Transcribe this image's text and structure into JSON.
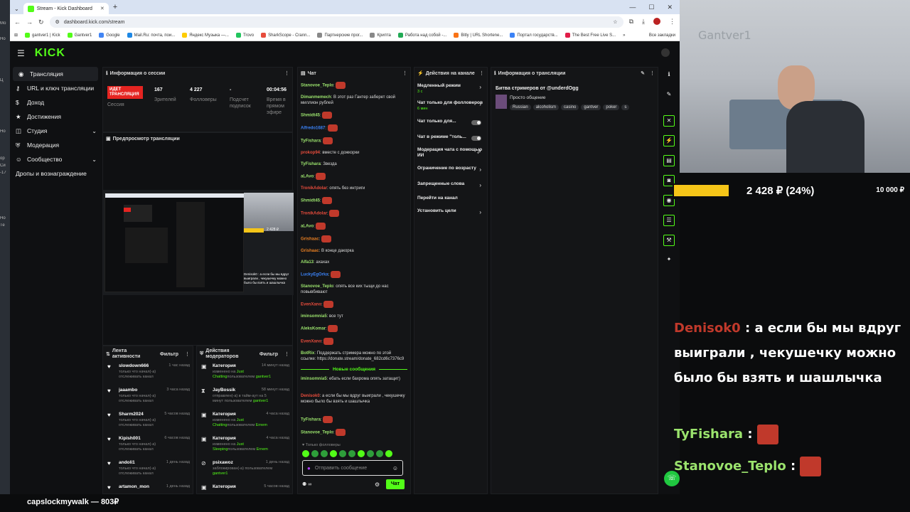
{
  "desktop": {
    "icons": [
      "Мо",
      "Но",
      "Ц",
      "Но",
      "ор",
      "Си",
      "-17",
      "Но",
      "Те"
    ]
  },
  "browser": {
    "tab_title": "Stream - Kick Dashboard",
    "new_tab": "+",
    "url": "dashboard.kick.com/stream",
    "bookmarks": [
      "gantver1 | Kick",
      "Gantver1",
      "Google",
      "Mail.Ru: почта, пои...",
      "Яндекс Музыка —...",
      "Trovo",
      "SharkScope - Crann...",
      "Партнерские прог...",
      "Крипта",
      "Работа над собой -...",
      "Bitly | URL Shortene...",
      "Портал государств...",
      "The Best Free Live S..."
    ],
    "bookmarks_all": "Все закладки"
  },
  "app": {
    "logo": "KICK",
    "sidebar": [
      {
        "label": "Трансляция",
        "active": true
      },
      {
        "label": "URL и ключ трансляции"
      },
      {
        "label": "Доход"
      },
      {
        "label": "Достижения"
      },
      {
        "label": "Студия",
        "chevron": "⌄"
      },
      {
        "label": "Модерация"
      },
      {
        "label": "Сообщество",
        "chevron": "⌄"
      },
      {
        "label": "Дропы и вознаграждение"
      }
    ],
    "session": {
      "title": "Информация о сессии",
      "live": "ИДЕТ ТРАНСЛЯЦИЯ",
      "live_label": "Сессия",
      "viewers": "167",
      "viewers_label": "Зрителей",
      "followers": "4 227",
      "followers_label": "Фолловеры",
      "subs": "-",
      "subs_label": "Подсчет подписок",
      "airtime": "00:04:56",
      "airtime_label": "Время в прямом эфире"
    },
    "preview": {
      "title": "Предпросмотр трансляции",
      "overlay_amount": "2 428 ₽",
      "overlay_chat": "Denisok0 : а если бы мы вдруг выиграли , чекушечку можно было бы взять и шашлычка"
    },
    "activity": {
      "title": "Лента активности",
      "filter": "Фильтр",
      "items": [
        {
          "user": "slowdown666",
          "time": "1 час назад",
          "text": "только что начал(-а) отслеживать канал"
        },
        {
          "user": "jaaambo",
          "time": "3 часа назад",
          "text": "только что начал(-а) отслеживать канал"
        },
        {
          "user": "Sharm2024",
          "time": "5 часов назад",
          "text": "только что начал(-а) отслеживать канал"
        },
        {
          "user": "Kipish001",
          "time": "6 часов назад",
          "text": "только что начал(-а) отслеживать канал"
        },
        {
          "user": "andoli1",
          "time": "1 день назад",
          "text": "только что начал(-а) отслеживать канал"
        },
        {
          "user": "artamon_mon",
          "time": "1 день назад",
          "text": ""
        }
      ]
    },
    "modactions": {
      "title": "Действия модераторов",
      "filter": "Фильтр",
      "items": [
        {
          "title": "Категория",
          "time": "14 минут назад",
          "text": "изменено на ",
          "hl": "Just Chatting",
          "by": "пользователем ",
          "mod": "gantver1"
        },
        {
          "title": "JayBossik",
          "time": "58 минут назад",
          "text": "отправлен(-а) в тайм-аут на 5 минут пользователем ",
          "hl": "",
          "by": "",
          "mod": "gantver1"
        },
        {
          "title": "Категория",
          "time": "4 часа назад",
          "text": "изменено на ",
          "hl": "Just Chatting",
          "by": "пользователем ",
          "mod": "Ernem"
        },
        {
          "title": "Категория",
          "time": "4 часа назад",
          "text": "изменено на ",
          "hl": "Just Sleeping",
          "by": "пользователем ",
          "mod": "Ernem"
        },
        {
          "title": "psixawoz",
          "time": "1 день назад",
          "text": "заблокирован(-а) пользователем ",
          "hl": "",
          "by": "",
          "mod": "gantver1"
        },
        {
          "title": "Категория",
          "time": "5 часов назад",
          "text": "",
          "hl": "",
          "by": "",
          "mod": ""
        }
      ]
    },
    "chat": {
      "title": "Чат",
      "messages": [
        {
          "user": "Stanovoe_Teplo",
          "color": "#9be36d",
          "text": "",
          "emote": true
        },
        {
          "user": "Dimanmemech",
          "color": "#9be36d",
          "text": "В этот раз Гантер заберет свой миллион рублей"
        },
        {
          "user": "Shmidt45",
          "color": "#9be36d",
          "text": "",
          "emote": true
        },
        {
          "user": "Alfredo1687",
          "color": "#3b82f6",
          "text": "",
          "emote": true
        },
        {
          "user": "TyFishara",
          "color": "#9be36d",
          "text": "",
          "emote": true
        },
        {
          "user": "prokop94",
          "color": "#e74c3c",
          "text": "вместе с дожкорки"
        },
        {
          "user": "TyFishara",
          "color": "#9be36d",
          "text": "Звезда"
        },
        {
          "user": "aLAvo",
          "color": "#9be36d",
          "text": "",
          "emote": true
        },
        {
          "user": "TronikAdolar",
          "color": "#e74c3c",
          "text": "опять без интриги"
        },
        {
          "user": "Shmidt45",
          "color": "#9be36d",
          "text": "",
          "emote": true
        },
        {
          "user": "TronikAdolar",
          "color": "#e74c3c",
          "text": "",
          "emote": true
        },
        {
          "user": "aLAvo",
          "color": "#9be36d",
          "text": "",
          "emote": true
        },
        {
          "user": "Grishaac",
          "color": "#e67e22",
          "text": "",
          "emote": true
        },
        {
          "user": "Grishaac",
          "color": "#e67e22",
          "text": "В конце дакорка"
        },
        {
          "user": "Alfa13",
          "color": "#9be36d",
          "text": "ахахах"
        },
        {
          "user": "LuckyEgOrka",
          "color": "#3b82f6",
          "text": "",
          "emote": true
        },
        {
          "user": "Stanovoe_Teplo",
          "color": "#9be36d",
          "text": "опять все ких тыщи до нас повывбивают"
        },
        {
          "user": "EvenXano",
          "color": "#e74c3c",
          "text": "",
          "emote": true
        },
        {
          "user": "iminsomnia5",
          "color": "#9be36d",
          "text": "все тут"
        },
        {
          "user": "AleksKomar",
          "color": "#9be36d",
          "text": "",
          "emote": true
        },
        {
          "user": "EvenXano",
          "color": "#e74c3c",
          "text": "",
          "emote": true
        },
        {
          "user": "BotRix",
          "color": "#9be36d",
          "text": "Поддержать стримера можно по этой ссылке: https://donate.stream/donate_682cd6c7376c9"
        }
      ],
      "new_messages": "Новые сообщения",
      "after": [
        {
          "user": "iminsomnia5",
          "color": "#9be36d",
          "text": "ебать если бахрома опять затащит)"
        },
        {
          "user": "Denisok0",
          "color": "#e74c3c",
          "text": "а если бы мы вдруг выиграли , чекушечку можно было бы взять и шашлычка"
        },
        {
          "user": "TyFishara",
          "color": "#9be36d",
          "text": "",
          "emote": true
        },
        {
          "user": "Stanovoe_Teplo",
          "color": "#9be36d",
          "text": "",
          "emote": true
        }
      ],
      "followers_only": "Только фолловеры",
      "input_placeholder": "Отправить сообщение",
      "send": "Чат",
      "infinity": "∞"
    },
    "channel_actions": {
      "title": "Действия на канале",
      "items": [
        {
          "label": "Медленный режим",
          "sub": "3 с",
          "control": "arrow"
        },
        {
          "label": "Чат только для фолловеров",
          "sub": "6 мин",
          "control": "arrow"
        },
        {
          "label": "Чат только для...",
          "sub": "",
          "control": "toggle"
        },
        {
          "label": "Чат в режиме \"толь...",
          "sub": "",
          "control": "toggle"
        },
        {
          "label": "Модерация чата с помощью ИИ",
          "sub": "",
          "control": "ext"
        },
        {
          "label": "Ограничение по возрасту",
          "sub": "",
          "control": "arrow"
        },
        {
          "label": "Запрещенные слова",
          "sub": "",
          "control": "arrow"
        },
        {
          "label": "Перейти на канал",
          "sub": "",
          "control": ""
        },
        {
          "label": "Установить цели",
          "sub": "",
          "control": "arrow"
        }
      ]
    },
    "stream_info": {
      "title": "Информация о трансляции",
      "stream_title": "Битва стримеров от @underdOgg",
      "category": "Просто общение",
      "tags": [
        "Russian",
        "alcoholism",
        "casino",
        "gantver",
        "poker",
        "s"
      ]
    }
  },
  "overlay": {
    "webcam_text": "Gantver1",
    "goal_amount": "2 428 ₽ (24%)",
    "goal_target": "10 000 ₽",
    "goal_fraction": 0.24,
    "chat": [
      {
        "user": "Denisok0",
        "text": " : а если бы мы вдруг выиграли , чекушечку можно было бы взять и шашлычка"
      },
      {
        "user": "TyFishara",
        "text": " : "
      },
      {
        "user": "Stanovoe_Teplo",
        "text": " : "
      }
    ],
    "ticker": "capslockmywalk — 803₽"
  },
  "colors": {
    "accent": "#53fc18",
    "live": "#e52421",
    "goal": "#f5c518"
  }
}
